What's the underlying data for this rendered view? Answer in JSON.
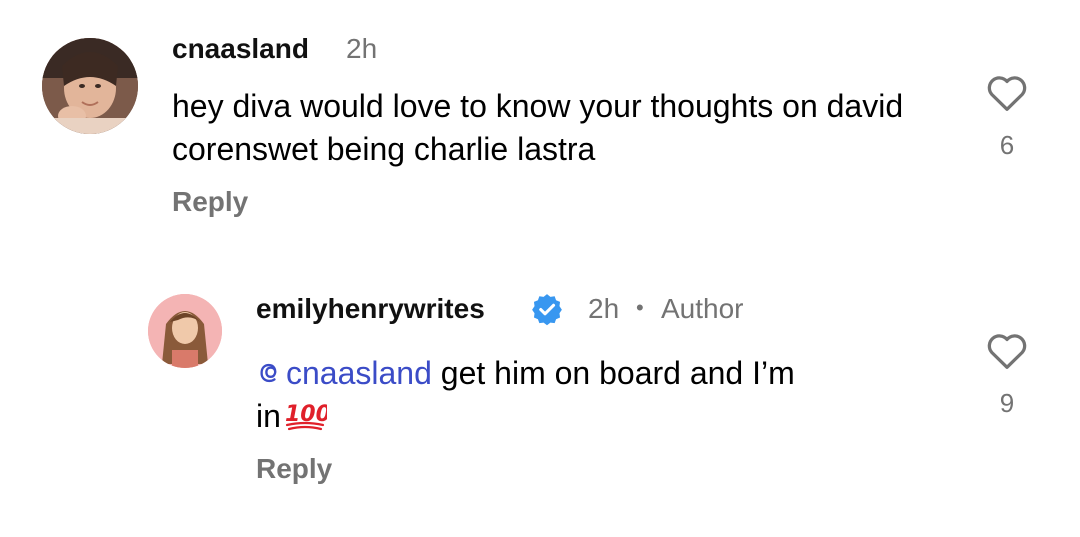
{
  "comments": [
    {
      "username": "cnaasland",
      "time": "2h",
      "text": "hey diva would love to know your thoughts on david corenswet being charlie lastra",
      "reply_label": "Reply",
      "likes": "6"
    },
    {
      "username": "emilyhenrywrites",
      "time": "2h",
      "separator": "•",
      "author_badge": "Author",
      "mention": "cnaasland",
      "text_line1": " get him on board and I’m",
      "text_line2": "in",
      "emoji_name": "hundred-points-emoji",
      "reply_label": "Reply",
      "likes": "9"
    }
  ],
  "icons": {
    "heart": "heart-outline-icon",
    "verified": "verified-badge-icon",
    "mention": "threads-at-icon"
  },
  "colors": {
    "meta": "#737373",
    "mention": "#3b4cc7",
    "verified": "#3897f0",
    "emoji_red": "#e0202a"
  }
}
